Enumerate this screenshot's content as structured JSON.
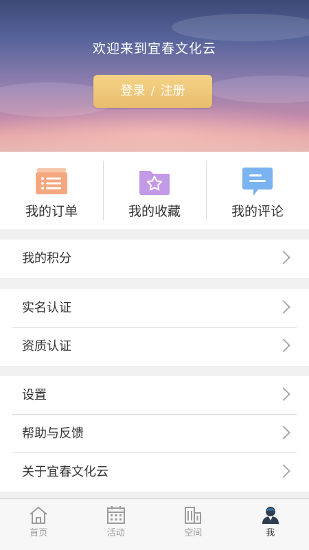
{
  "header": {
    "welcome": "欢迎来到宜春文化云",
    "login_label": "登录",
    "divider": "/",
    "register_label": "注册"
  },
  "quick_actions": [
    {
      "label": "我的订单",
      "icon": "order-list-icon",
      "color": "#f5a77f"
    },
    {
      "label": "我的收藏",
      "icon": "favorite-folder-icon",
      "color": "#c39ae6"
    },
    {
      "label": "我的评论",
      "icon": "comment-icon",
      "color": "#7ab3f0"
    }
  ],
  "menu": {
    "points": "我的积分",
    "realname": "实名认证",
    "qualification": "资质认证",
    "settings": "设置",
    "help": "帮助与反馈",
    "about": "关于宜春文化云"
  },
  "tabbar": [
    {
      "label": "首页",
      "icon": "home-icon",
      "active": false
    },
    {
      "label": "活动",
      "icon": "calendar-icon",
      "active": false
    },
    {
      "label": "空间",
      "icon": "building-icon",
      "active": false
    },
    {
      "label": "我",
      "icon": "user-icon",
      "active": true
    }
  ],
  "colors": {
    "accent_button": "#ebc070",
    "tab_inactive": "#9b9b9b",
    "tab_active": "#333333"
  }
}
